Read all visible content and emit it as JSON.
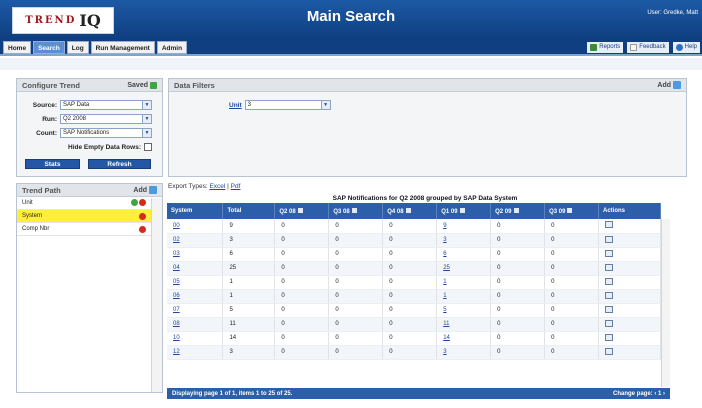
{
  "header": {
    "logo_word": "TREND",
    "logo_iq": "IQ",
    "title": "Main Search",
    "user": "User: Gredke, Matt"
  },
  "nav": {
    "tabs": [
      "Home",
      "Search",
      "Log",
      "Run Management",
      "Admin"
    ],
    "active_tab": "Search",
    "links": [
      "Reports",
      "Feedback",
      "Help"
    ]
  },
  "configure_trend": {
    "title": "Configure Trend",
    "saved_label": "Saved",
    "source_label": "Source:",
    "source_value": "SAP Data",
    "run_label": "Run:",
    "run_value": "Q2 2008",
    "count_label": "Count:",
    "count_value": "SAP Notifications",
    "hide_empty_label": "Hide Empty Data Rows:",
    "stats_label": "Stats",
    "refresh_label": "Refresh"
  },
  "data_filters": {
    "title": "Data Filters",
    "add_label": "Add",
    "unit_label": "Unit",
    "unit_value": "3"
  },
  "trend_path": {
    "title": "Trend Path",
    "add_label": "Add",
    "items": [
      "Unit",
      "System",
      "Comp Nbr"
    ],
    "selected": "System"
  },
  "export": {
    "label": "Export Types:",
    "excel": "Excel",
    "separator": "|",
    "pdf": "Pdf"
  },
  "table": {
    "title": "SAP Notifications for Q2 2008 grouped by SAP Data System",
    "columns": [
      "System",
      "Total",
      "Q2 08",
      "Q3 08",
      "Q4 08",
      "Q1 09",
      "Q2 09",
      "Q3 09",
      "Actions"
    ],
    "rows": [
      [
        "00",
        "9",
        "0",
        "0",
        "0",
        "9",
        "0",
        "0"
      ],
      [
        "02",
        "3",
        "0",
        "0",
        "0",
        "3",
        "0",
        "0"
      ],
      [
        "03",
        "6",
        "0",
        "0",
        "0",
        "6",
        "0",
        "0"
      ],
      [
        "04",
        "25",
        "0",
        "0",
        "0",
        "25",
        "0",
        "0"
      ],
      [
        "05",
        "1",
        "0",
        "0",
        "0",
        "1",
        "0",
        "0"
      ],
      [
        "06",
        "1",
        "0",
        "0",
        "0",
        "1",
        "0",
        "0"
      ],
      [
        "07",
        "5",
        "0",
        "0",
        "0",
        "5",
        "0",
        "0"
      ],
      [
        "08",
        "11",
        "0",
        "0",
        "0",
        "11",
        "0",
        "0"
      ],
      [
        "10",
        "14",
        "0",
        "0",
        "0",
        "14",
        "0",
        "0"
      ],
      [
        "12",
        "3",
        "0",
        "0",
        "0",
        "3",
        "0",
        "0"
      ]
    ],
    "footer_left": "Displaying page 1 of 1, items 1 to 25 of 25.",
    "footer_right": "Change page:",
    "page_arrows": "‹ 1 ›"
  },
  "colors": {
    "header_blue": "#1d5aa6",
    "table_header": "#2c5ea9",
    "selected_row": "#ffef3a",
    "remove_red": "#d9281c",
    "ok_green": "#3fa53f"
  }
}
